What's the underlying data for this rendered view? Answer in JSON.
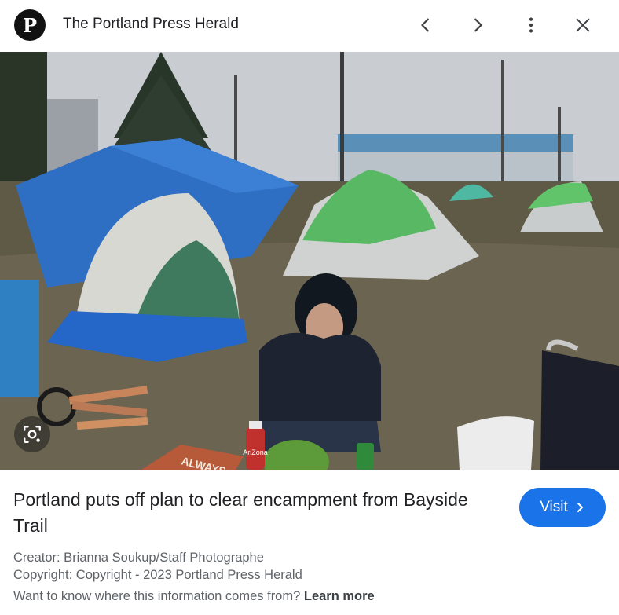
{
  "header": {
    "logo_letter": "P",
    "site_name": "The Portland Press Herald",
    "prev_icon": "chevron-left-icon",
    "next_icon": "chevron-right-icon",
    "more_icon": "more-vert-icon",
    "close_icon": "close-icon"
  },
  "image": {
    "lens_icon": "google-lens-icon",
    "sign_text": "ALWAYS",
    "can_text": "AriZona"
  },
  "caption": {
    "headline": "Portland puts off plan to clear encampment from Bayside Trail",
    "visit_label": "Visit",
    "creator": "Creator: Brianna Soukup/Staff Photographe",
    "copyright": "Copyright: Copyright - 2023 Portland Press Herald",
    "info_text": "Want to know where this information comes from?",
    "learn_more": "Learn more"
  },
  "colors": {
    "accent": "#1a73e8",
    "text": "#202124",
    "muted": "#5f6368"
  }
}
